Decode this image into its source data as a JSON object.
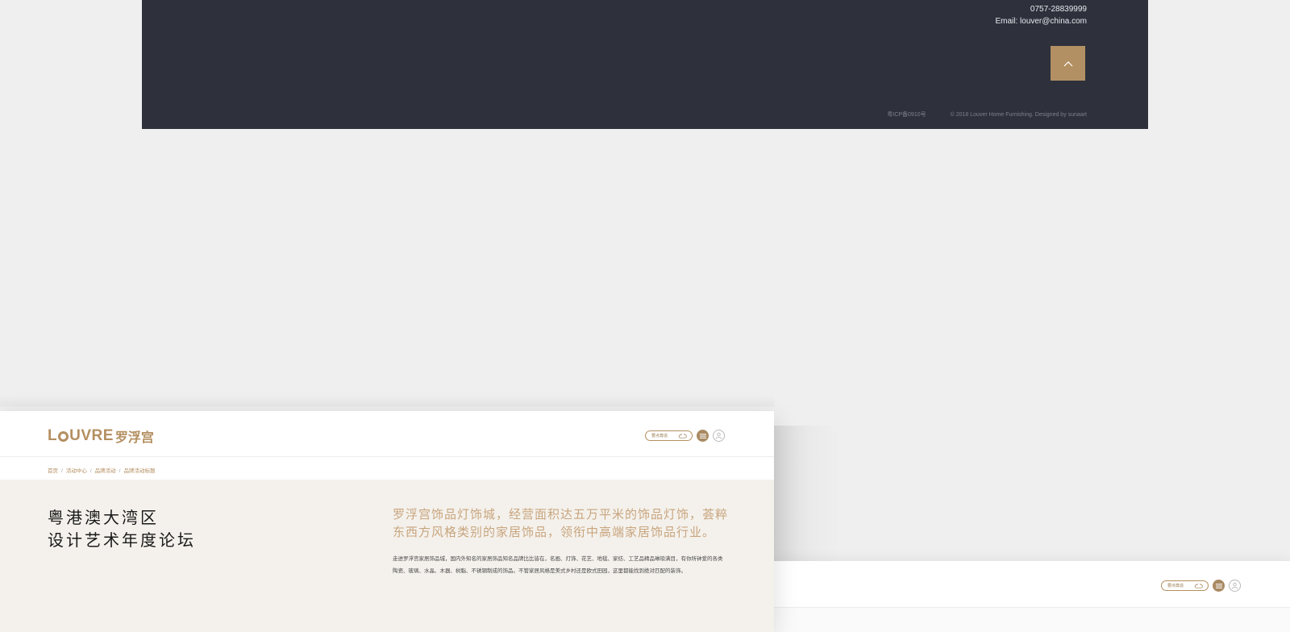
{
  "footer": {
    "phone": "0757-28839999",
    "email": "Email: louver@china.com",
    "icp": "粤ICP备0910号",
    "copyright": "© 2018 Louver Home Furnishing. Designed by sunaart",
    "back_top_icon": "chevron-up-icon"
  },
  "header": {
    "logo_en_prefix": "L",
    "logo_en_suffix": "UVRE",
    "logo_cn": "罗浮宫",
    "order_label": "要点尊造",
    "menu_icon": "hamburger-icon",
    "user_icon": "user-icon"
  },
  "breadcrumb": [
    {
      "label": "首页"
    },
    {
      "label": "活动中心"
    },
    {
      "label": "品牌活动"
    },
    {
      "label": "品牌活动标题"
    }
  ],
  "article": {
    "title_line1": "粤港澳大湾区",
    "title_line2": "设计艺术年度论坛",
    "intro_heading": "罗浮宫饰品灯饰城，经营面积达五万平米的饰品灯饰，荟粹东西方风格类别的家居饰品，领衔中高端家居饰品行业。",
    "intro_body": "走进罗浮宫家居饰品城，国内外知名的家居饰品知名品牌比比皆在，名画、灯饰、花艺、地毯、家纺、工艺品精品琳琅满目，有你所钟爱的各类陶瓷、玻璃、水晶、木器、树脂、不锈钢制成的饰品。不管家居风格是美式乡村还是欧式田园，这里都能找到绝对匹配的装饰。"
  },
  "secondary_header": {
    "order_label": "要点尊造"
  },
  "colors": {
    "brand_gold": "#b48f61",
    "footer_bg": "#2e313c",
    "content_bg": "#f4f1ec",
    "page_bg": "#efefef"
  }
}
